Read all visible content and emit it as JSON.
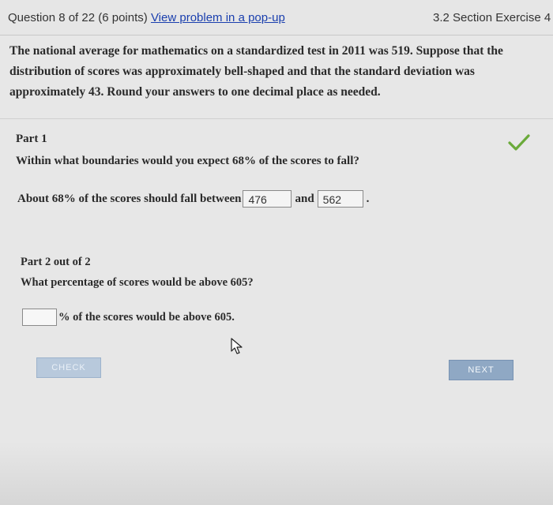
{
  "header": {
    "question_label": "Question 8 of 22 (6 points)",
    "popup_link": "View problem in a pop-up",
    "section": "3.2 Section Exercise 4"
  },
  "problem": {
    "statement": "The national average for mathematics on a standardized test in 2011 was 519. Suppose that the distribution of scores was approximately bell-shaped and that the standard deviation was approximately 43. Round your answers to one decimal place as needed."
  },
  "part1": {
    "title": "Part 1",
    "question": "Within what boundaries would you expect 68% of the scores to fall?",
    "answer_prefix": "About 68% of the scores should fall between",
    "answer_low": "476",
    "and_word": "and",
    "answer_high": "562",
    "suffix": ".",
    "status_icon": "checkmark-icon",
    "status_color": "#6aaa3a"
  },
  "part2": {
    "title": "Part 2 out of 2",
    "question": "What percentage of scores would be above 605?",
    "input_value": "",
    "answer_suffix": "% of the scores would be above 605."
  },
  "buttons": {
    "check": "CHECK",
    "next": "NEXT"
  }
}
